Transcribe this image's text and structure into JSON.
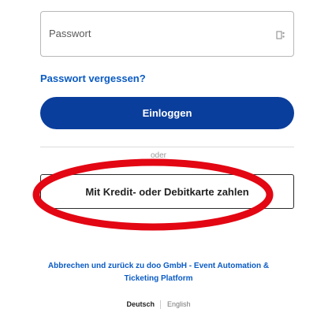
{
  "password_field": {
    "placeholder": "Passwort",
    "icon": "password-toggle-icon"
  },
  "forgot_password": "Passwort vergessen?",
  "login_button": "Einloggen",
  "divider": "oder",
  "card_button": "Mit Kredit- oder Debitkarte zahlen",
  "annotation": {
    "color": "#e30613"
  },
  "cancel_link": {
    "line1": "Abbrechen und zurück zu doo GmbH - Event Automation &",
    "line2": "Ticketing Platform"
  },
  "languages": {
    "active": "Deutsch",
    "other": "English"
  },
  "colors": {
    "primary": "#0a3e9c",
    "link": "#0a5bc4"
  }
}
